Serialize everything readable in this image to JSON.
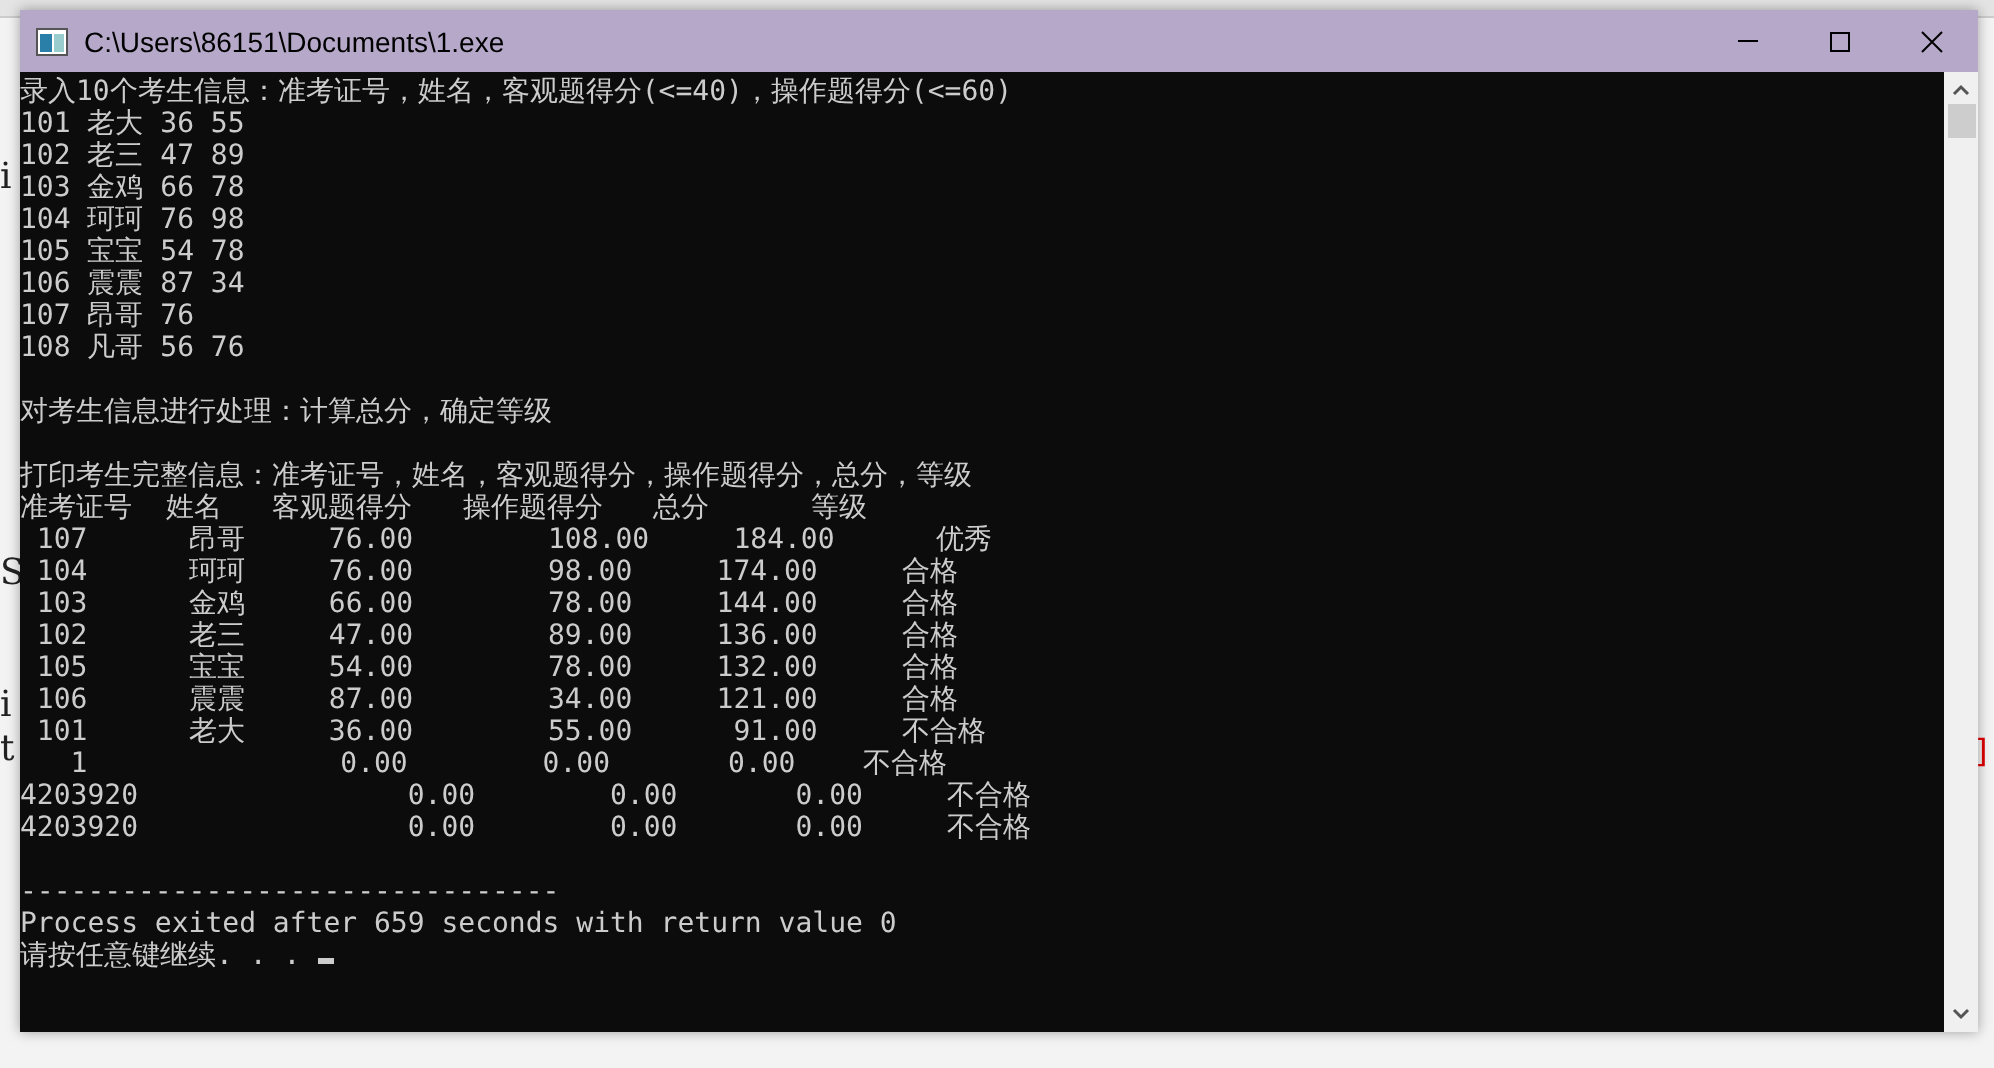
{
  "background_editor": {
    "left_fragments": [
      {
        "text": "i"
      },
      {
        "text": "S"
      },
      {
        "text": "i"
      },
      {
        "text": "t"
      }
    ],
    "right_fragment": "]"
  },
  "window": {
    "title": "C:\\Users\\86151\\Documents\\1.exe"
  },
  "console": {
    "blocks": [
      [
        "录入10个考生信息：准考证号，姓名，客观题得分(<=40)，操作题得分(<=60)",
        "101 老大 36 55",
        "102 老三 47 89",
        "103 金鸡 66 78",
        "104 珂珂 76 98",
        "105 宝宝 54 78",
        "106 震震 87 34",
        "107 昂哥 76",
        "108 凡哥 56 76"
      ],
      [
        "对考生信息进行处理：计算总分，确定等级"
      ],
      [
        "打印考生完整信息：准考证号，姓名，客观题得分，操作题得分，总分，等级",
        "准考证号  姓名   客观题得分   操作题得分   总分      等级",
        " 107      昂哥     76.00        108.00     184.00      优秀",
        " 104      珂珂     76.00        98.00     174.00     合格",
        " 103      金鸡     66.00        78.00     144.00     合格",
        " 102      老三     47.00        89.00     136.00     合格",
        " 105      宝宝     54.00        78.00     132.00     合格",
        " 106      震震     87.00        34.00     121.00     合格",
        " 101      老大     36.00        55.00      91.00     不合格",
        "   1               0.00        0.00       0.00    不合格",
        "4203920                0.00        0.00       0.00     不合格",
        "4203920                0.00        0.00       0.00     不合格"
      ],
      [
        "--------------------------------",
        "Process exited after 659 seconds with return value 0",
        "请按任意键继续. . . "
      ]
    ],
    "cursor": true
  }
}
